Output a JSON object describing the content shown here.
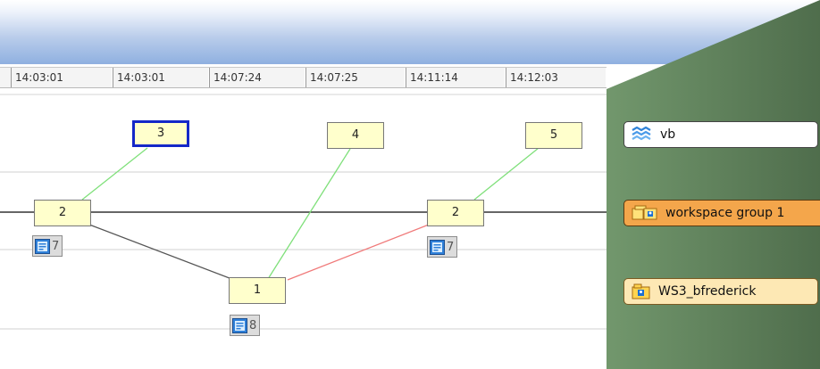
{
  "timeline": {
    "timestamps": [
      "14:03:01",
      "14:03:01",
      "14:07:24",
      "14:07:25",
      "14:11:14",
      "14:12:03"
    ]
  },
  "nodes": [
    {
      "label": "3"
    },
    {
      "label": "4"
    },
    {
      "label": "5"
    },
    {
      "label": "2"
    },
    {
      "label": "2"
    },
    {
      "label": "1"
    }
  ],
  "badges": [
    {
      "count": "7"
    },
    {
      "count": "7"
    },
    {
      "count": "8"
    }
  ],
  "side_panel": {
    "items": [
      {
        "label": "vb",
        "icon": "vb-waves-icon"
      },
      {
        "label": "workspace group 1",
        "icon": "workspace-group-icon"
      },
      {
        "label": "WS3_bfrederick",
        "icon": "workspace-user-icon"
      }
    ]
  },
  "colors": {
    "edge_green": "#7fe07a",
    "edge_red": "#f07a7a",
    "edge_gray": "#555555",
    "node_fill": "#ffffcc",
    "selected_border": "#1428c8"
  }
}
